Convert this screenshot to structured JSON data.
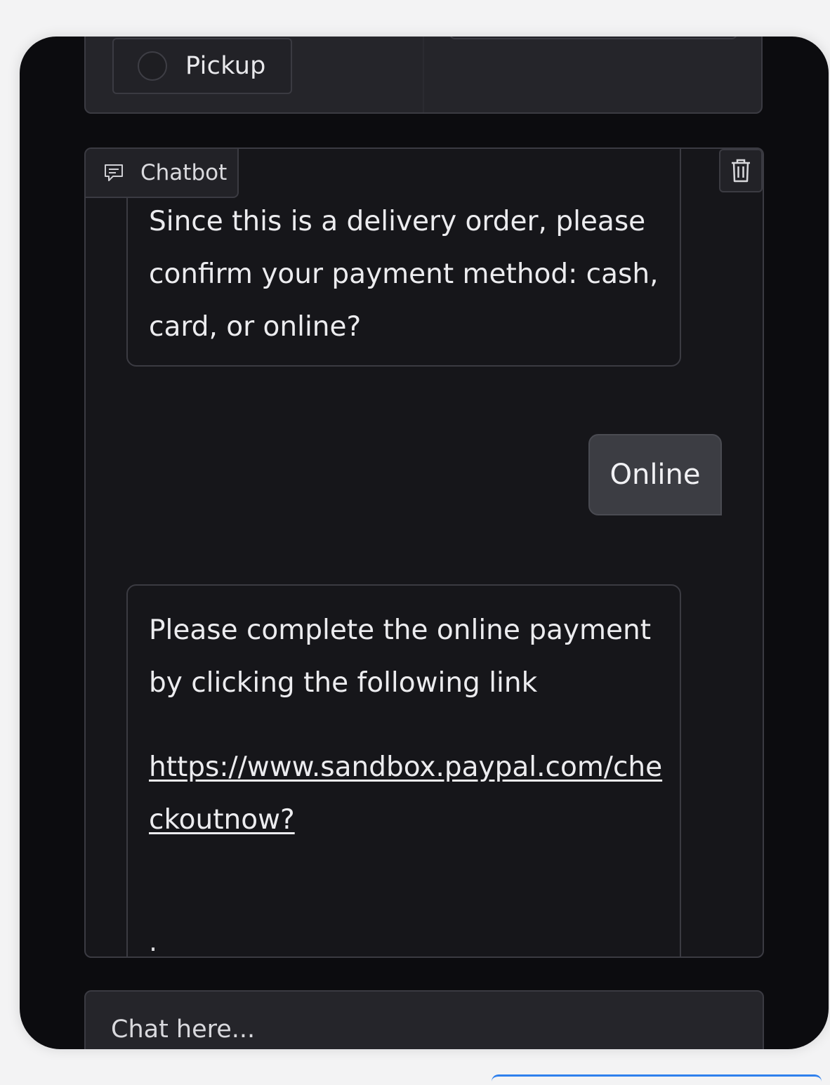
{
  "order_type": {
    "option_label": "Pickup"
  },
  "chatbot": {
    "label": "Chatbot",
    "clear_icon": "trash-icon",
    "label_icon": "chat-bubble-icon",
    "messages": [
      {
        "role": "bot",
        "text": "Since this is a delivery order, please confirm your payment method: cash, card, or online?"
      },
      {
        "role": "user",
        "text": "Online"
      },
      {
        "role": "bot",
        "text": "Please complete the online payment by clicking the following link",
        "link": "https://www.sandbox.paypal.com/checkoutnow?",
        "trailing": "."
      }
    ]
  },
  "input": {
    "placeholder": "Chat here..."
  },
  "colors": {
    "background": "#0c0c0f",
    "panel": "#25252a",
    "border": "#3b3b42",
    "user_bubble": "#3c3d43",
    "accent": "#2f80ed"
  }
}
